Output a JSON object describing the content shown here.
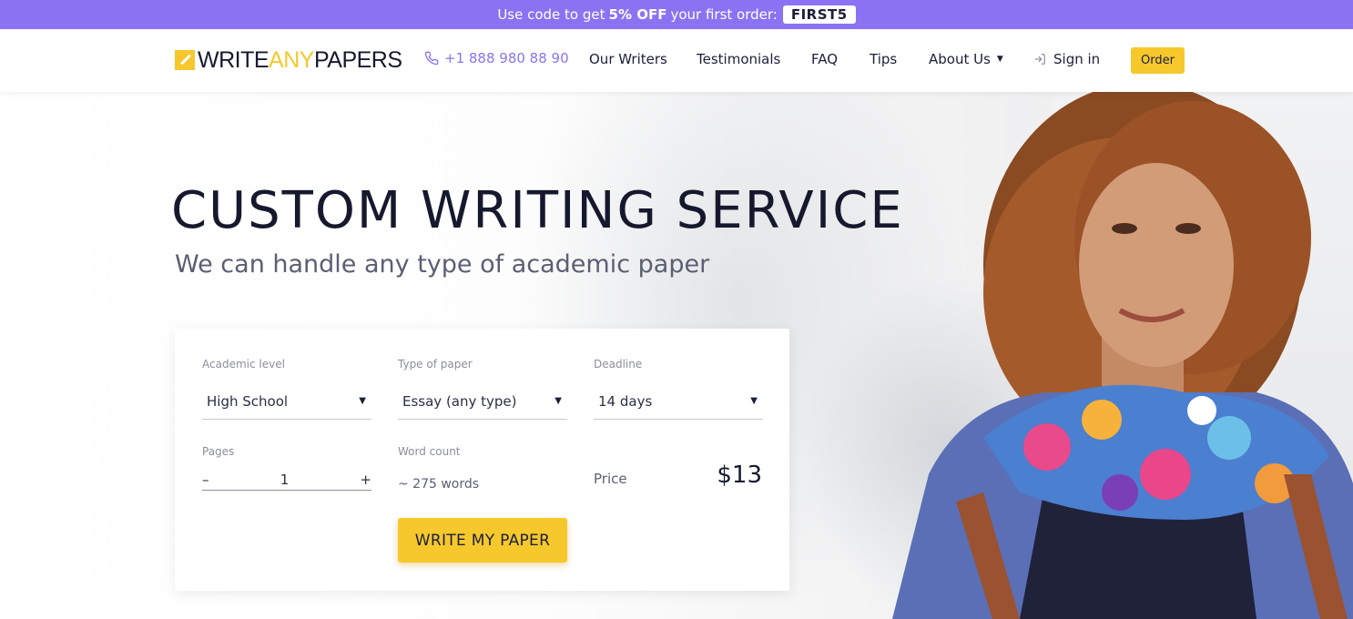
{
  "promo": {
    "text_before": "Use code to get",
    "discount": "5% OFF",
    "text_after": "your first order:",
    "code": "FIRST5",
    "color": "#8a73f3"
  },
  "header": {
    "logo": {
      "part1": "WRITE",
      "part2": "ANY",
      "part3": "PAPERS"
    },
    "phone": "+1 888 980 88 90",
    "nav": [
      "Our Writers",
      "Testimonials",
      "FAQ",
      "Tips",
      "About Us"
    ],
    "signin": "Sign in",
    "order": "Order",
    "accent": "#f6c82c"
  },
  "hero": {
    "title": "CUSTOM WRITING SERVICE",
    "subtitle": "We can handle any type of academic paper"
  },
  "form": {
    "academic_level": {
      "label": "Academic level",
      "value": "High School"
    },
    "type_of_paper": {
      "label": "Type of paper",
      "value": "Essay (any type)"
    },
    "deadline": {
      "label": "Deadline",
      "value": "14 days"
    },
    "pages": {
      "label": "Pages",
      "value": "1",
      "minus": "–",
      "plus": "+"
    },
    "word_count": {
      "label": "Word count",
      "value": "~ 275 words"
    },
    "price": {
      "label": "Price",
      "value": "$13"
    },
    "submit": "WRITE MY PAPER"
  }
}
